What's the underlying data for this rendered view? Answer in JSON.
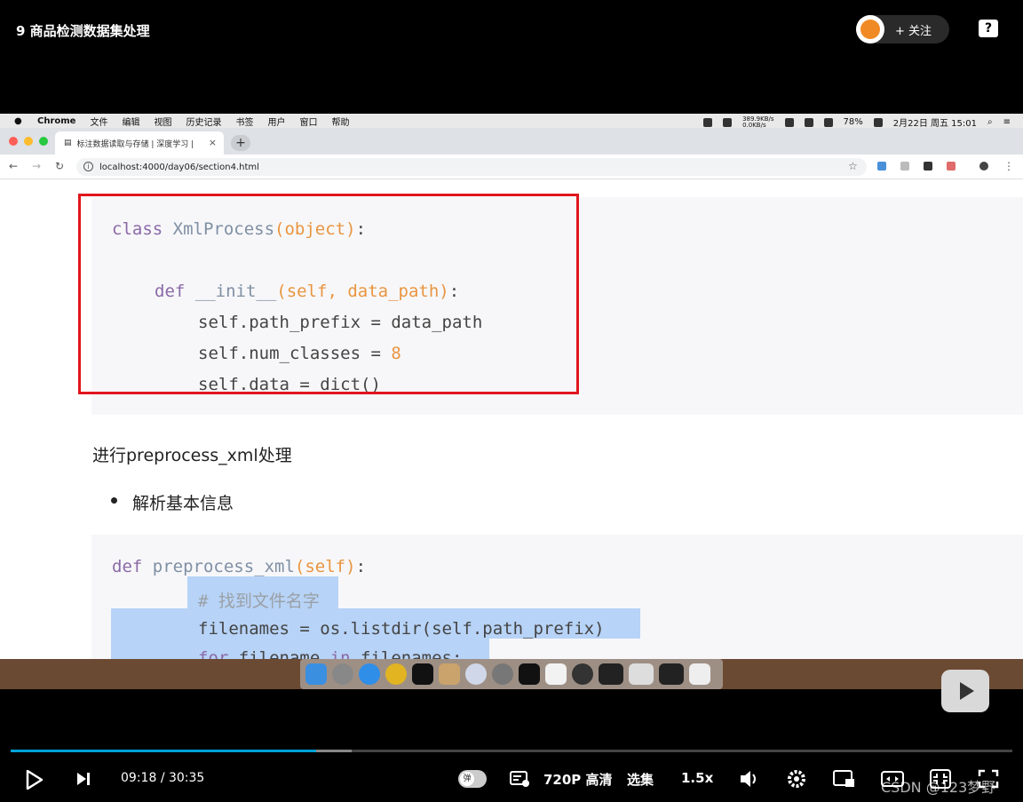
{
  "player": {
    "title": "9 商品检测数据集处理",
    "follow_label": "+ 关注",
    "help_icon": "?",
    "current_time": "09:18",
    "time_separator": "/",
    "duration": "30:35",
    "progress_fraction": 0.305,
    "buffered_fraction": 0.34,
    "danmu_label": "弹",
    "quality_label": "720P 高清",
    "episodes_label": "选集",
    "speed_label": "1.5x",
    "watermark": "CSDN @123梦野"
  },
  "menubar": {
    "app": "Chrome",
    "items": [
      "文件",
      "编辑",
      "视图",
      "历史记录",
      "书签",
      "用户",
      "窗口",
      "帮助"
    ],
    "net_up": "389.9KB/s",
    "net_down": "0.0KB/s",
    "battery": "78%",
    "datetime": "2月22日 周五 15:01"
  },
  "browser": {
    "tab_title": "标注数据读取与存储 | 深度学习 |",
    "tab_close": "×",
    "new_tab": "+",
    "url": "localhost:4000/day06/section4.html"
  },
  "content": {
    "code1": {
      "line1_kw": "class",
      "line1_name": " XmlProcess",
      "line1_args": "(object)",
      "line1_end": ":",
      "line2_kw": "def",
      "line2_name": " __init__",
      "line2_args": "(self, data_path)",
      "line2_end": ":",
      "line3": "self.path_prefix = data_path",
      "line4_a": "self.num_classes = ",
      "line4_num": "8",
      "line5": "self.data = dict()"
    },
    "paragraph": "进行preprocess_xml处理",
    "bullet": "解析基本信息",
    "code2": {
      "line1_kw": "def",
      "line1_name": " preprocess_xml",
      "line1_args": "(self)",
      "line1_end": ":",
      "line2": "# 找到文件名字",
      "line3": "filenames = os.listdir(self.path_prefix)",
      "line4_kw1": "for",
      "line4_a": " filename ",
      "line4_kw2": "in",
      "line4_b": " filenames:"
    }
  },
  "colors": {
    "accent": "#00a1d6",
    "highlight_box": "#e0161d",
    "keyword": "#8b6aa8",
    "argument": "#e99540"
  }
}
